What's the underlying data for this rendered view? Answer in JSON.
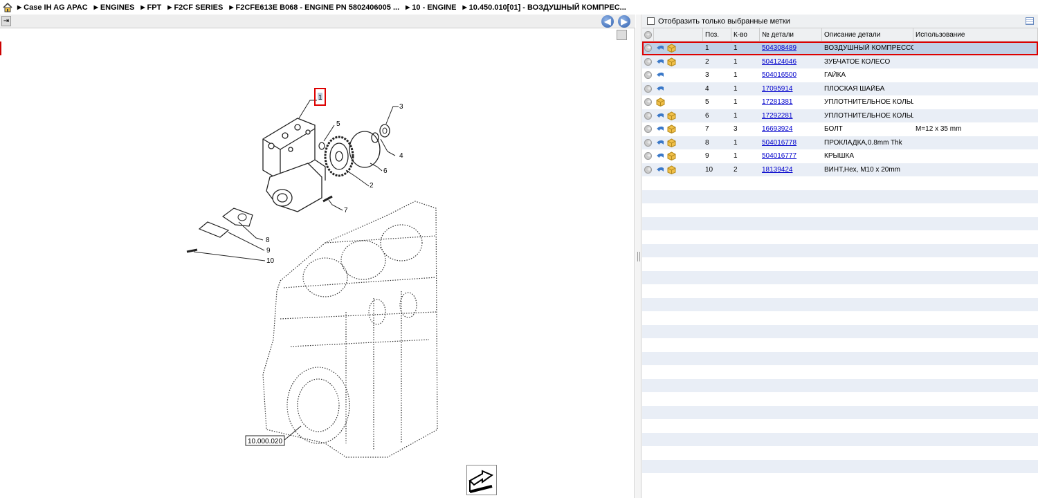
{
  "breadcrumb": [
    "Case IH AG APAC",
    "ENGINES",
    "FPT",
    "F2CF SERIES",
    "F2CFE613E B068 - ENGINE PN 5802406005 ...",
    "10 - ENGINE",
    "10.450.010[01] - ВОЗДУШНЫЙ КОМПРЕС..."
  ],
  "diagram": {
    "callouts": [
      "1",
      "2",
      "3",
      "4",
      "5",
      "6",
      "7",
      "8",
      "9",
      "10"
    ],
    "ref_label": "10.000.020"
  },
  "panel": {
    "filter_label": "Отобразить только выбранные метки",
    "columns": [
      "Поз.",
      "К-во",
      "№ детали",
      "Описание детали",
      "Использование"
    ]
  },
  "parts": [
    {
      "pos": "1",
      "qty": "1",
      "pn": "504308489",
      "desc": "ВОЗДУШНЫЙ КОМПРЕССОР",
      "use": ""
    },
    {
      "pos": "2",
      "qty": "1",
      "pn": "504124646",
      "desc": "ЗУБЧАТОЕ КОЛЕСО",
      "use": ""
    },
    {
      "pos": "3",
      "qty": "1",
      "pn": "504016500",
      "desc": "ГАЙКА",
      "use": ""
    },
    {
      "pos": "4",
      "qty": "1",
      "pn": "17095914",
      "desc": "ПЛОСКАЯ ШАЙБА",
      "use": ""
    },
    {
      "pos": "5",
      "qty": "1",
      "pn": "17281381",
      "desc": "УПЛОТНИТЕЛЬНОЕ КОЛЬЦ",
      "use": ""
    },
    {
      "pos": "6",
      "qty": "1",
      "pn": "17292281",
      "desc": "УПЛОТНИТЕЛЬНОЕ КОЛЬЦ",
      "use": ""
    },
    {
      "pos": "7",
      "qty": "3",
      "pn": "16693924",
      "desc": "БОЛТ",
      "use": "M=12 x 35 mm"
    },
    {
      "pos": "8",
      "qty": "1",
      "pn": "504016778",
      "desc": "ПРОКЛАДКА,0.8mm Thk",
      "use": ""
    },
    {
      "pos": "9",
      "qty": "1",
      "pn": "504016777",
      "desc": "КРЫШКА",
      "use": ""
    },
    {
      "pos": "10",
      "qty": "2",
      "pn": "18139424",
      "desc": "ВИНТ,Hex, M10 x 20mm",
      "use": ""
    }
  ],
  "row_icons": [
    [
      "plus-icon",
      "back-arrow-icon",
      "box-icon"
    ],
    [
      "plus-icon",
      "back-arrow-icon",
      "box-icon"
    ],
    [
      "plus-icon",
      "back-arrow-icon"
    ],
    [
      "plus-icon",
      "back-arrow-icon"
    ],
    [
      "plus-icon",
      "box-icon"
    ],
    [
      "plus-icon",
      "back-arrow-icon",
      "box-icon"
    ],
    [
      "plus-icon",
      "back-arrow-icon",
      "box-icon"
    ],
    [
      "plus-icon",
      "back-arrow-icon",
      "box-icon"
    ],
    [
      "plus-icon",
      "back-arrow-icon",
      "box-icon"
    ],
    [
      "plus-icon",
      "back-arrow-icon",
      "box-icon"
    ]
  ],
  "selected_row": 0,
  "colors": {
    "link": "#0000cc",
    "highlight": "#d00000",
    "row_alt": "#e9eef6",
    "row_selected": "#bfd0e6"
  }
}
